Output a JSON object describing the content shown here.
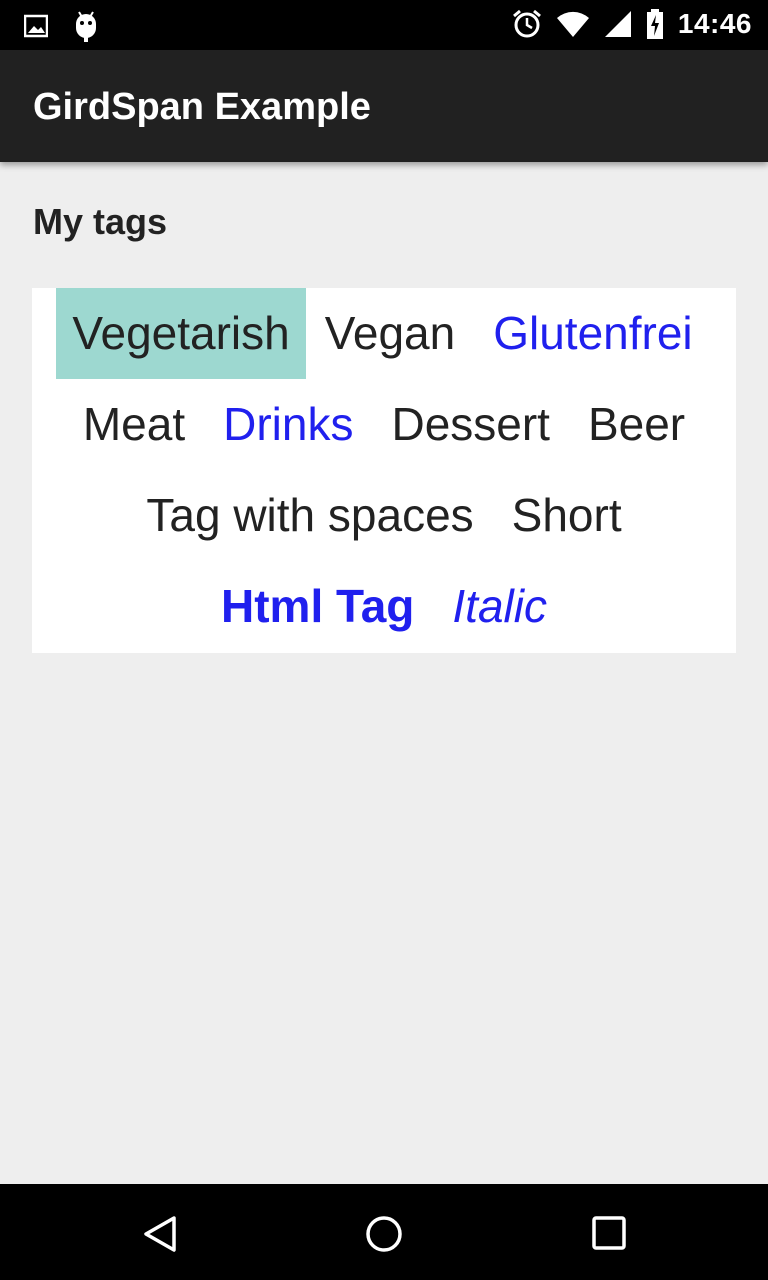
{
  "status_bar": {
    "time": "14:46",
    "icons": [
      "image-icon",
      "android-icon",
      "alarm-icon",
      "wifi-icon",
      "signal-icon",
      "battery-icon"
    ]
  },
  "app_bar": {
    "title": "GirdSpan Example"
  },
  "content": {
    "section_title": "My tags",
    "tag_rows": [
      [
        {
          "label": "Vegetarish",
          "style": "selected"
        },
        {
          "label": "Vegan",
          "style": "normal"
        },
        {
          "label": "Glutenfrei",
          "style": "link"
        }
      ],
      [
        {
          "label": "Meat",
          "style": "normal"
        },
        {
          "label": "Drinks",
          "style": "link"
        },
        {
          "label": "Dessert",
          "style": "normal"
        },
        {
          "label": "Beer",
          "style": "normal"
        }
      ],
      [
        {
          "label": "Tag with spaces",
          "style": "normal"
        },
        {
          "label": "Short",
          "style": "normal"
        }
      ],
      [
        {
          "label": "Html Tag",
          "style": "link bold"
        },
        {
          "label": "Italic",
          "style": "link italic"
        }
      ]
    ],
    "colors": {
      "selected_bg": "#9dd8d0",
      "link": "#2020ee",
      "text": "#222222"
    }
  },
  "nav_bar": {
    "icons": [
      "back-icon",
      "home-icon",
      "recents-icon"
    ]
  }
}
